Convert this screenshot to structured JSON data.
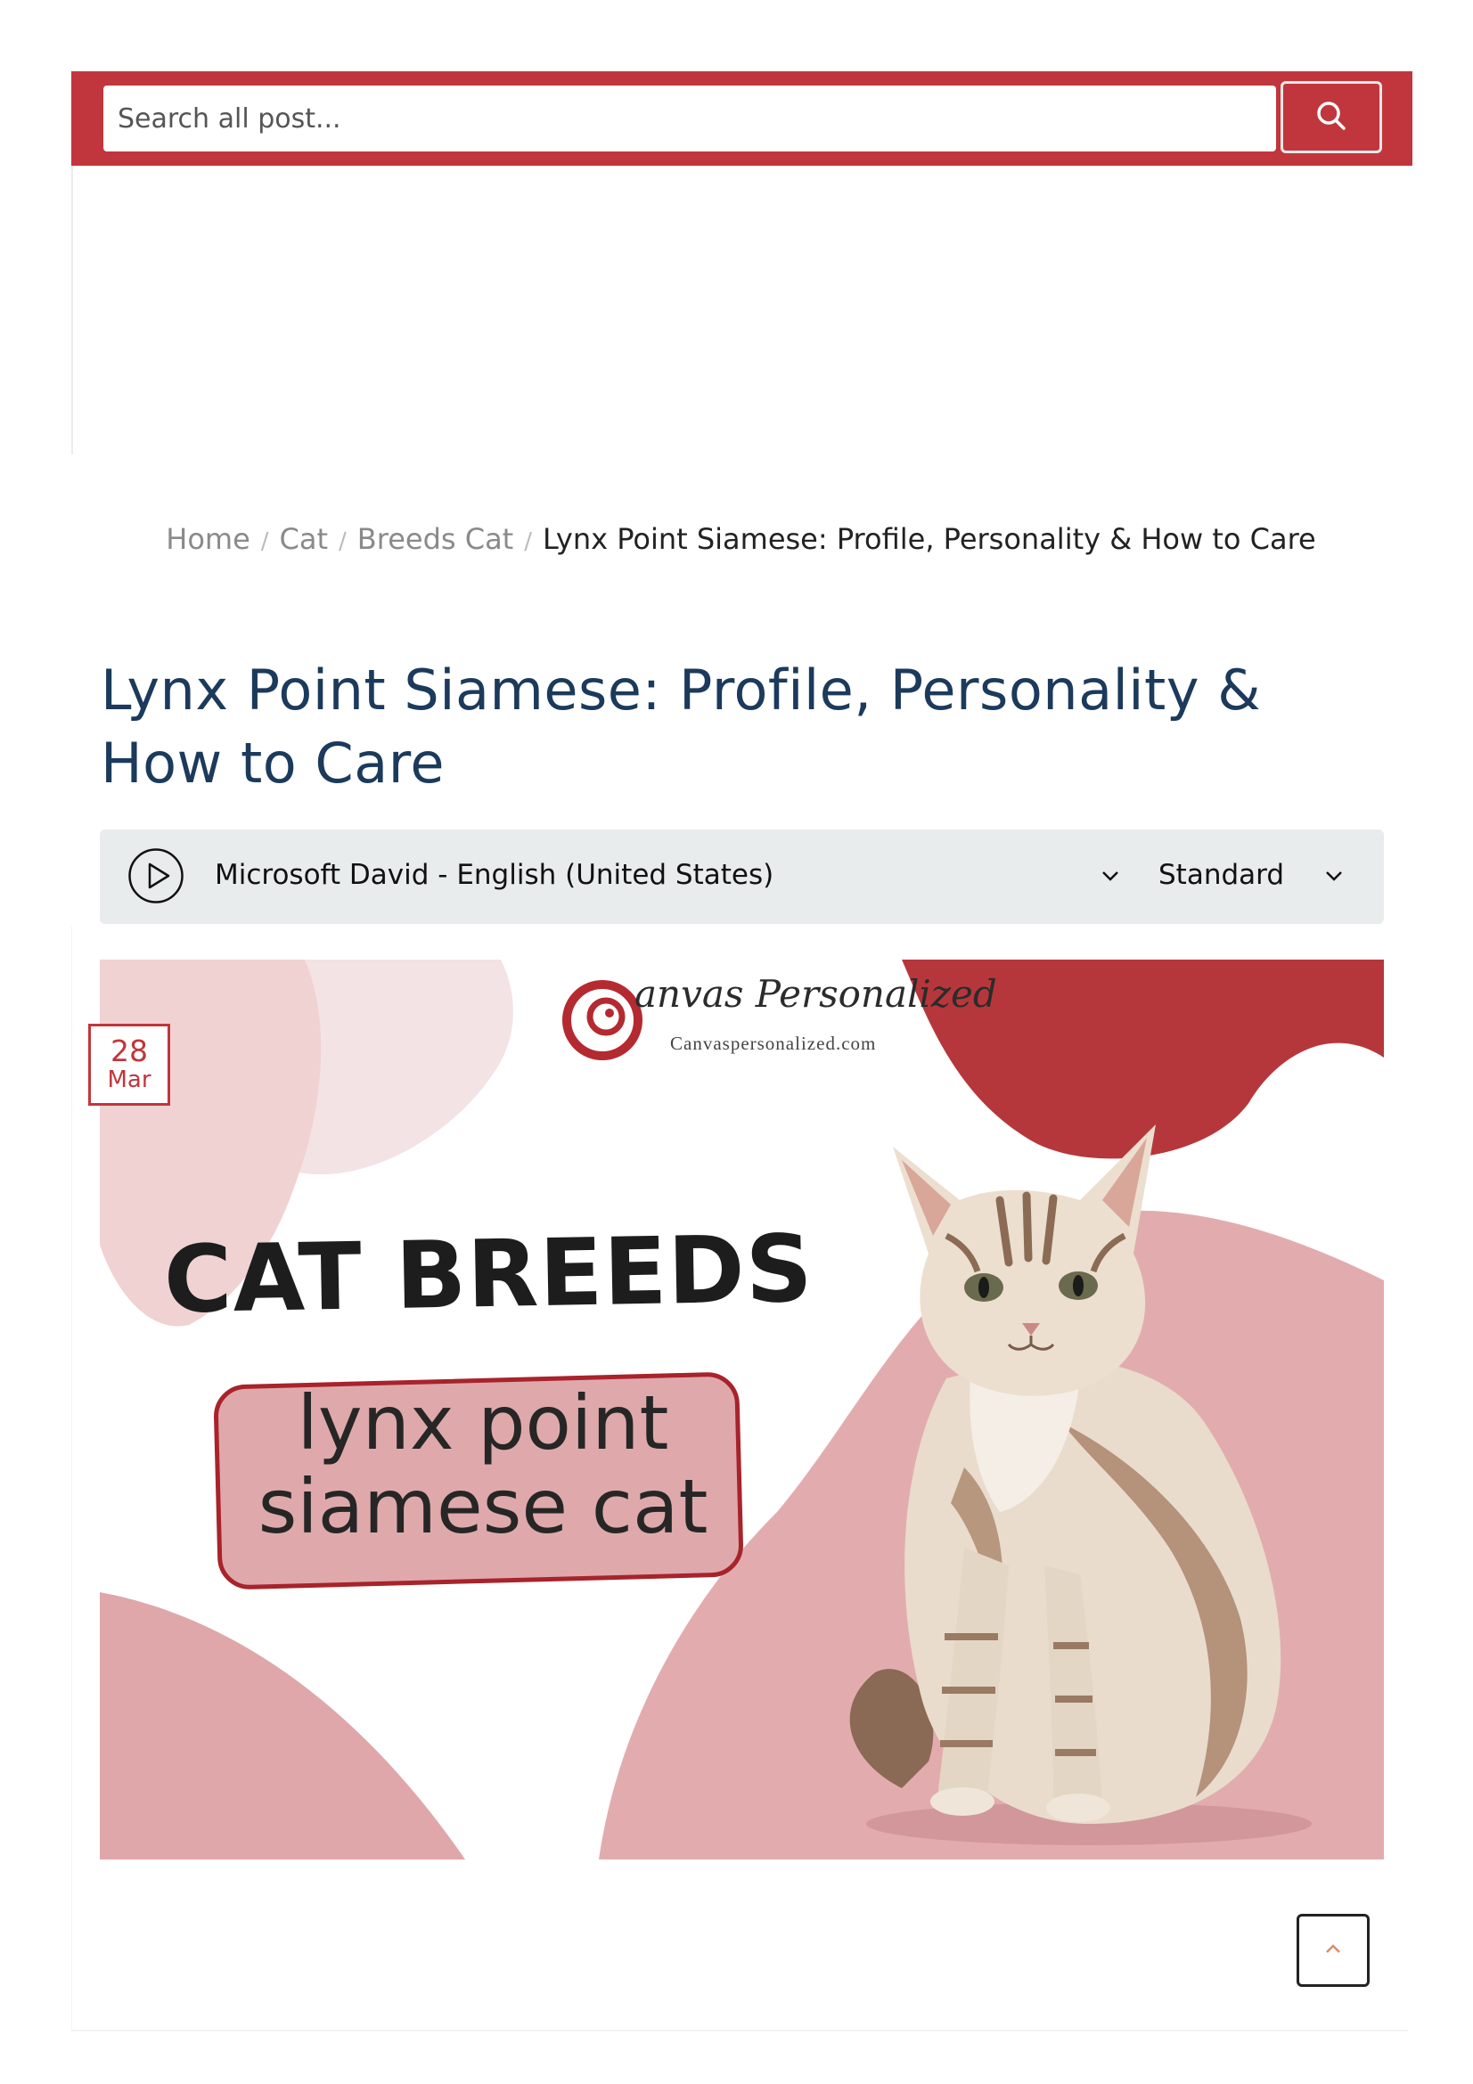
{
  "search": {
    "placeholder": "Search all post...",
    "icon": "search-icon"
  },
  "breadcrumb": {
    "items": [
      "Home",
      "Cat",
      "Breeds Cat"
    ],
    "separator": "/",
    "current": "Lynx Point Siamese: Profile, Personality & How to Care"
  },
  "article": {
    "title": "Lynx Point Siamese: Profile, Personality & How to Care",
    "date": {
      "day": "28",
      "month": "Mar"
    }
  },
  "tts_player": {
    "voice": "Microsoft David - English (United States)",
    "speed": "Standard"
  },
  "featured_image": {
    "brand_name": "anvas Personalized",
    "brand_url": "Canvaspersonalized.com",
    "headline": "CAT BREEDS",
    "subtitle_line1": "lynx point",
    "subtitle_line2": "siamese cat"
  },
  "colors": {
    "accent": "#c1363c",
    "title": "#1b3a5c",
    "blob_pink": "#e0aaad",
    "blob_light": "#f1dcdd",
    "player_bg": "#e8eced"
  }
}
